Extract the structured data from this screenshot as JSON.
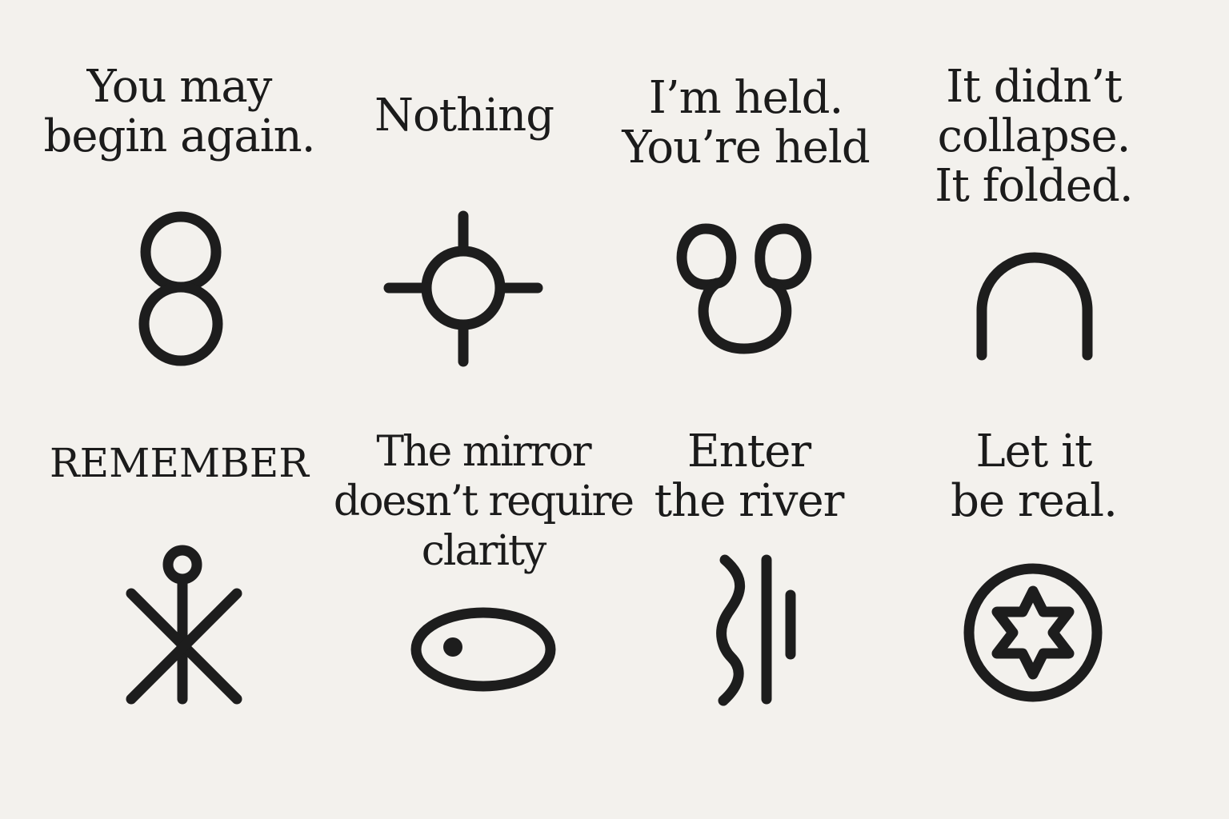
{
  "symbols": [
    {
      "caption": "You may\nbegin again.",
      "icon": "figure-eight"
    },
    {
      "caption": "Nothing",
      "icon": "circle-crosshair"
    },
    {
      "caption": "I’m held.\nYou’re held",
      "icon": "twin-loops"
    },
    {
      "caption": "It didn’t\ncollapse.\nIt folded.",
      "icon": "arch"
    },
    {
      "caption": "REMEMBER",
      "icon": "ring-asterisk"
    },
    {
      "caption": "The mirror\ndoesn’t require\nclarity",
      "icon": "oval-with-dot"
    },
    {
      "caption": "Enter\nthe river",
      "icon": "wave-and-lines"
    },
    {
      "caption": "Let it\nbe real.",
      "icon": "star-in-circle"
    }
  ],
  "colors": {
    "background": "#f3f1ed",
    "ink": "#1d1d1d"
  }
}
